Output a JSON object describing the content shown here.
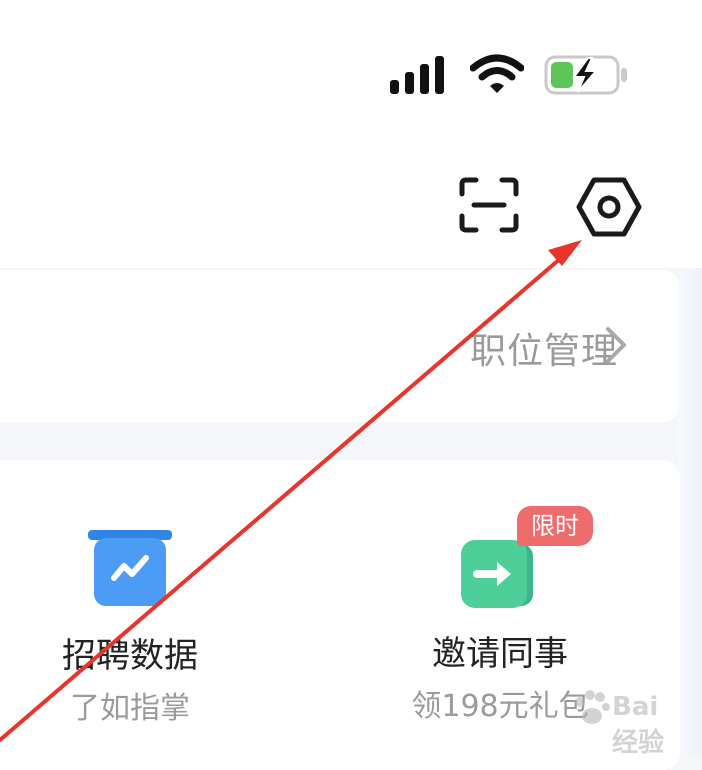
{
  "status_bar": {
    "signal_icon": "cellular-signal-icon",
    "wifi_icon": "wifi-icon",
    "battery_icon": "battery-charging-icon",
    "battery_color": "#5dc55a"
  },
  "header": {
    "scan_icon": "scan-icon",
    "settings_icon": "settings-icon"
  },
  "position_card": {
    "link_label": "职位管理"
  },
  "tools": [
    {
      "title": "招聘数据",
      "subtitle": "了如指掌",
      "icon": "data-chart-icon",
      "color": "#4c9bf5"
    },
    {
      "title": "邀请同事",
      "subtitle": "领198元礼包",
      "icon": "invite-arrow-icon",
      "color": "#4ecf9a",
      "badge": "限时",
      "badge_color": "#ee6c6c"
    }
  ],
  "annotation": {
    "arrow_color": "#e8342a"
  },
  "watermark": {
    "text": "Bai 经验"
  }
}
